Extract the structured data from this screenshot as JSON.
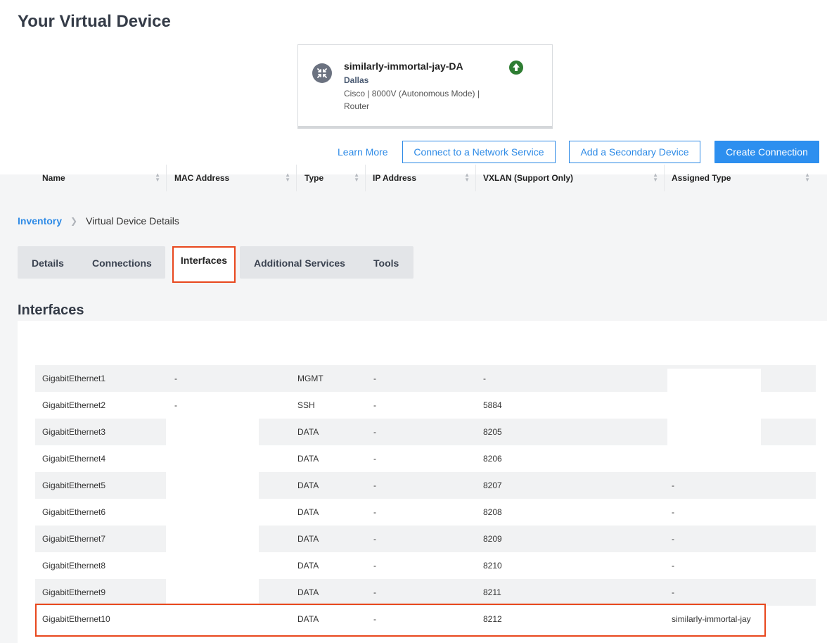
{
  "page": {
    "title": "Your Virtual Device"
  },
  "device": {
    "name": "similarly-immortal-jay-DA",
    "metro": "Dallas",
    "description": "Cisco | 8000V (Autonomous Mode) | Router",
    "device_icon": "router-icon",
    "status_icon": "arrow-up-circle-icon",
    "status_color": "#2e7d32"
  },
  "actions": {
    "learn_more": "Learn More",
    "connect_network_service": "Connect to a Network Service",
    "add_secondary_device": "Add a Secondary Device",
    "create_connection": "Create Connection"
  },
  "breadcrumb": {
    "root": "Inventory",
    "current": "Virtual Device Details"
  },
  "tabs": {
    "details": "Details",
    "connections": "Connections",
    "interfaces": "Interfaces",
    "additional_services": "Additional Services",
    "tools": "Tools",
    "active": "Interfaces"
  },
  "section": {
    "title": "Interfaces"
  },
  "table": {
    "columns": [
      "Name",
      "MAC Address",
      "Type",
      "IP Address",
      "VXLAN (Support Only)",
      "Assigned Type"
    ],
    "rows": [
      {
        "name": "GigabitEthernet1",
        "mac": "-",
        "type": "MGMT",
        "ip": "-",
        "vxlan": "-",
        "assigned": ""
      },
      {
        "name": "GigabitEthernet2",
        "mac": "-",
        "type": "SSH",
        "ip": "-",
        "vxlan": "5884",
        "assigned": ""
      },
      {
        "name": "GigabitEthernet3",
        "mac": "",
        "type": "DATA",
        "ip": "-",
        "vxlan": "8205",
        "assigned": ""
      },
      {
        "name": "GigabitEthernet4",
        "mac": "",
        "type": "DATA",
        "ip": "-",
        "vxlan": "8206",
        "assigned": ""
      },
      {
        "name": "GigabitEthernet5",
        "mac": "",
        "type": "DATA",
        "ip": "-",
        "vxlan": "8207",
        "assigned": "-"
      },
      {
        "name": "GigabitEthernet6",
        "mac": "",
        "type": "DATA",
        "ip": "-",
        "vxlan": "8208",
        "assigned": "-"
      },
      {
        "name": "GigabitEthernet7",
        "mac": "",
        "type": "DATA",
        "ip": "-",
        "vxlan": "8209",
        "assigned": "-"
      },
      {
        "name": "GigabitEthernet8",
        "mac": "",
        "type": "DATA",
        "ip": "-",
        "vxlan": "8210",
        "assigned": "-"
      },
      {
        "name": "GigabitEthernet9",
        "mac": "",
        "type": "DATA",
        "ip": "-",
        "vxlan": "8211",
        "assigned": "-"
      },
      {
        "name": "GigabitEthernet10",
        "mac": "",
        "type": "DATA",
        "ip": "-",
        "vxlan": "8212",
        "assigned": "similarly-immortal-jay"
      }
    ]
  },
  "colors": {
    "accent": "#2d8ae6",
    "highlight": "#e8471d"
  }
}
